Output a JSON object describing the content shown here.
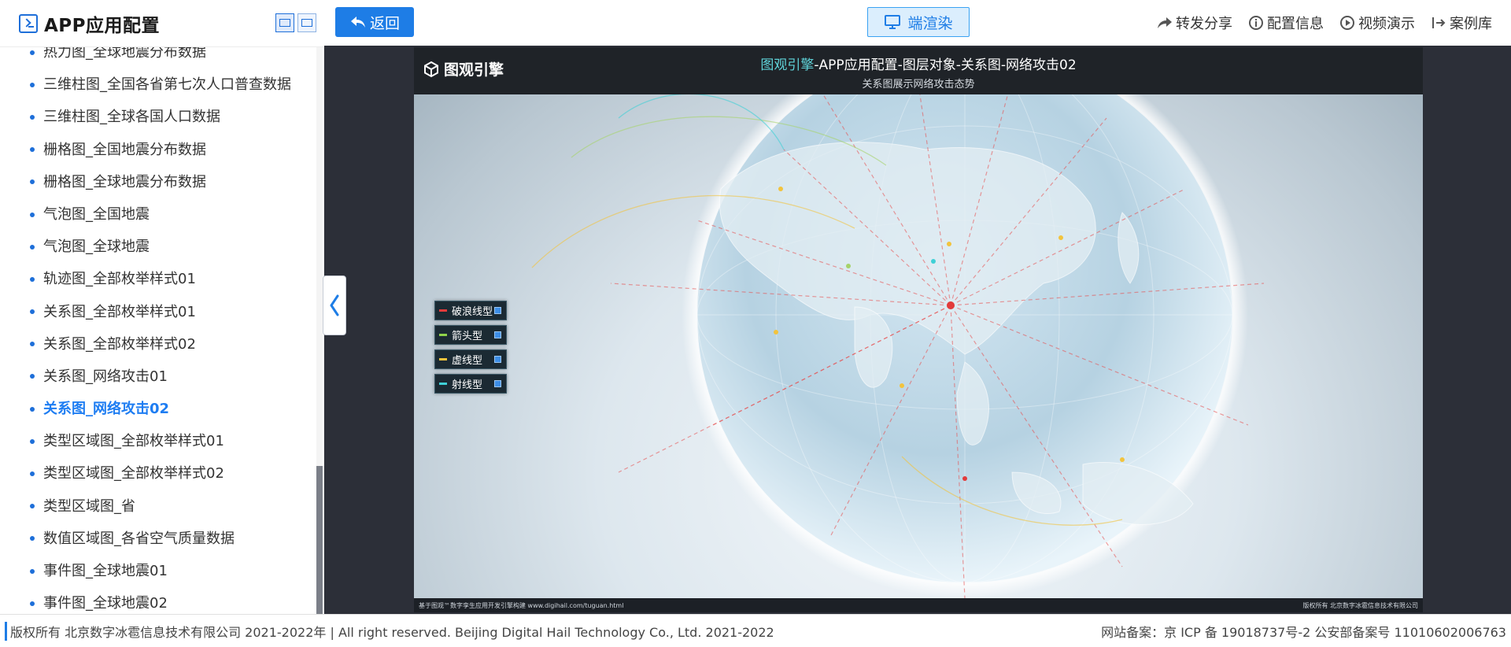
{
  "sidebar": {
    "title": "APP应用配置",
    "items": [
      {
        "label": "热力图_全球地震分布数据"
      },
      {
        "label": "三维柱图_全国各省第七次人口普查数据"
      },
      {
        "label": "三维柱图_全球各国人口数据"
      },
      {
        "label": "栅格图_全国地震分布数据"
      },
      {
        "label": "栅格图_全球地震分布数据"
      },
      {
        "label": "气泡图_全国地震"
      },
      {
        "label": "气泡图_全球地震"
      },
      {
        "label": "轨迹图_全部枚举样式01"
      },
      {
        "label": "关系图_全部枚举样式01"
      },
      {
        "label": "关系图_全部枚举样式02"
      },
      {
        "label": "关系图_网络攻击01"
      },
      {
        "label": "关系图_网络攻击02",
        "active": true
      },
      {
        "label": "类型区域图_全部枚举样式01"
      },
      {
        "label": "类型区域图_全部枚举样式02"
      },
      {
        "label": "类型区域图_省"
      },
      {
        "label": "数值区域图_各省空气质量数据"
      },
      {
        "label": "事件图_全球地震01"
      },
      {
        "label": "事件图_全球地震02"
      }
    ]
  },
  "topbar": {
    "back_label": "返回",
    "render_label": "端渲染",
    "links": [
      {
        "label": "转发分享",
        "icon": "share-icon"
      },
      {
        "label": "配置信息",
        "icon": "info-icon"
      },
      {
        "label": "视频演示",
        "icon": "play-icon"
      },
      {
        "label": "案例库",
        "icon": "export-icon"
      }
    ]
  },
  "scene": {
    "logo_text": "图观引擎",
    "title_highlight": "图观引擎",
    "title_rest": "-APP应用配置-图层对象-关系图-网络攻击02",
    "subtitle": "关系图展示网络攻击态势",
    "legend": [
      {
        "label": "破浪线型",
        "color": "#e23b3b"
      },
      {
        "label": "箭头型",
        "color": "#8fd14a"
      },
      {
        "label": "虚线型",
        "color": "#f2c33d"
      },
      {
        "label": "射线型",
        "color": "#3fd0d6"
      }
    ],
    "footer_left": "基于图观™数字孪生应用开发引擎构建 www.digihail.com/tuguan.html",
    "footer_right": "版权所有 北京数字冰雹信息技术有限公司"
  },
  "footer": {
    "copyright": "版权所有 北京数字冰雹信息技术有限公司 2021-2022年 | All right reserved. Beijing Digital Hail Technology Co., Ltd. 2021-2022",
    "icp": "网站备案：京 ICP 备 19018737号-2 公安部备案号 11010602006763"
  },
  "colors": {
    "accent": "#1e7de6",
    "highlight": "#5fd3d9"
  }
}
